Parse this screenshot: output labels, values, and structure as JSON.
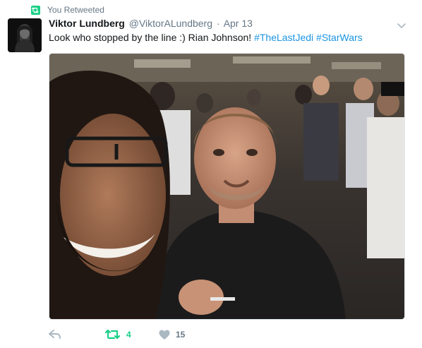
{
  "context": {
    "label": "You Retweeted"
  },
  "tweet": {
    "author_name": "Viktor Lundberg",
    "author_handle": "@ViktorALundberg",
    "separator": "·",
    "time": "Apr 13",
    "text_plain": "Look who stopped by the line :) Rian Johnson! ",
    "hashtags": [
      "#TheLastJedi",
      "#StarWars"
    ]
  },
  "actions": {
    "retweet_count": "4",
    "like_count": "15"
  },
  "colors": {
    "retweet_green": "#19cf86",
    "link_blue": "#1b95e0",
    "secondary_gray": "#657786",
    "action_gray": "#aab8c2"
  },
  "icons": {
    "retweet_badge": "retweet-icon",
    "caret": "chevron-down-icon",
    "reply": "reply-icon",
    "retweet": "retweet-icon",
    "like": "heart-icon"
  }
}
